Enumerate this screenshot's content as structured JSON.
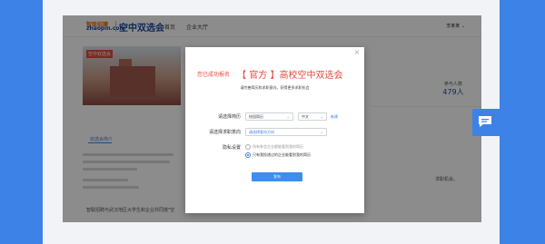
{
  "header": {
    "logo_top": "智联招聘",
    "logo_bottom": "zhaopin.com",
    "brand": "空中双选会",
    "nav": [
      "首页",
      "企业大厅"
    ],
    "user": "李某某"
  },
  "banner": {
    "tag": "空中双选会"
  },
  "stats": {
    "label": "参与人数",
    "value": "479人"
  },
  "background": {
    "tab": "双选会简介",
    "right_snippet": "求职机会。",
    "footer_snippet": "智联招聘与武汉地区大学生和企业共同搭\"空"
  },
  "modal": {
    "prefix": "您已成功报名",
    "title": "【 官方 】高校空中双选会",
    "subtitle": "请完善简历和求职意向，获得更多求职机会",
    "resume_label": "请选择简历",
    "resume_value": "校园简历",
    "lang_value": "中文",
    "add_link": "新建",
    "intention_label": "请选择求职意向",
    "intention_placeholder": "请选择意向方向",
    "privacy_label": "隐私设置",
    "privacy_options": [
      "所有参会企业都能看到我的简历",
      "只有我投递过的企业能看到我的简历"
    ],
    "privacy_selected": 1,
    "publish_label": "发布"
  },
  "colors": {
    "accent": "#3d82e6",
    "title_red": "#e8483c",
    "brand_blue": "#1d4aa0"
  },
  "icons": [
    "close-icon",
    "chevron-down-icon",
    "chat-icon"
  ]
}
